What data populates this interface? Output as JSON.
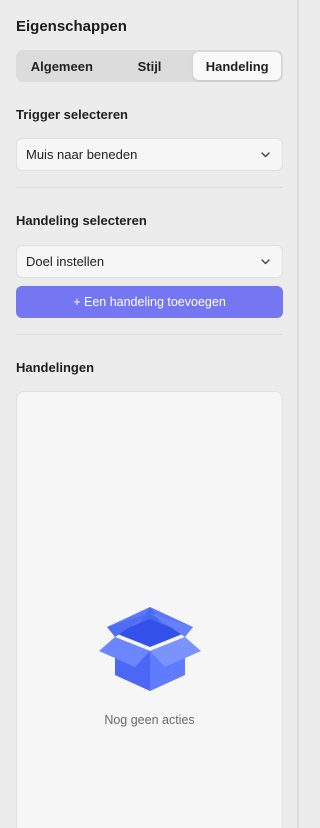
{
  "panel": {
    "title": "Eigenschappen"
  },
  "tabs": [
    {
      "label": "Algemeen",
      "active": false
    },
    {
      "label": "Stijl",
      "active": false
    },
    {
      "label": "Handeling",
      "active": true
    }
  ],
  "trigger": {
    "label": "Trigger selecteren",
    "value": "Muis naar beneden"
  },
  "action_select": {
    "label": "Handeling selecteren",
    "value": "Doel instellen"
  },
  "add_button": {
    "label": "+ Een handeling toevoegen"
  },
  "actions_list": {
    "label": "Handelingen",
    "empty_text": "Nog geen acties",
    "empty_icon": "open-box-icon"
  },
  "colors": {
    "accent": "#7476f2",
    "box_blue": "#4a67f5"
  }
}
